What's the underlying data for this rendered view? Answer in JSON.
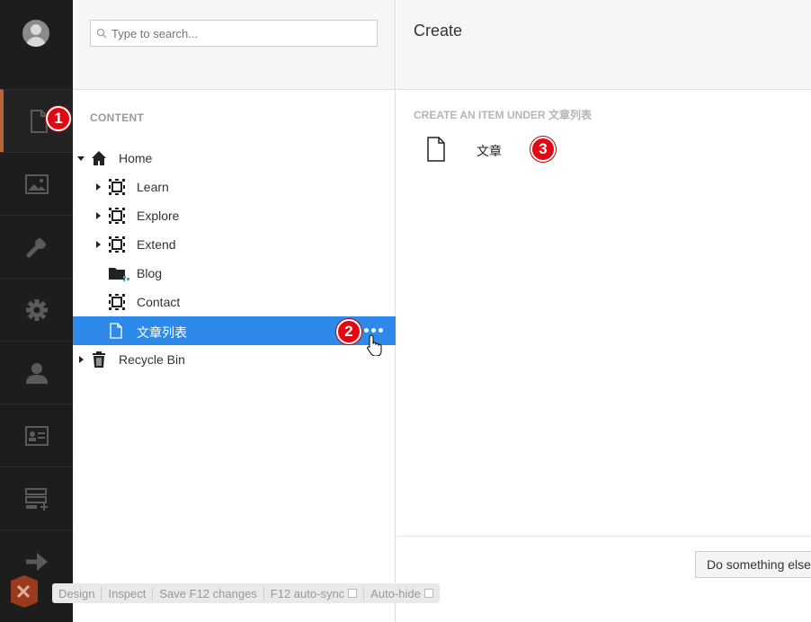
{
  "rail": {
    "items": [
      {
        "name": "content",
        "icon": "document-icon",
        "active": true
      },
      {
        "name": "media",
        "icon": "image-icon"
      },
      {
        "name": "settings",
        "icon": "wrench-icon"
      },
      {
        "name": "developer",
        "icon": "gear-icon"
      },
      {
        "name": "users",
        "icon": "user-icon"
      },
      {
        "name": "members",
        "icon": "id-card-icon"
      },
      {
        "name": "forms",
        "icon": "forms-icon"
      },
      {
        "name": "redirect",
        "icon": "arrow-right-icon"
      }
    ]
  },
  "badges": {
    "b1": "1",
    "b2": "2",
    "b3": "3"
  },
  "search": {
    "placeholder": "Type to search..."
  },
  "tree": {
    "section_title": "CONTENT",
    "nodes": [
      {
        "label": "Home"
      },
      {
        "label": "Learn"
      },
      {
        "label": "Explore"
      },
      {
        "label": "Extend"
      },
      {
        "label": "Blog"
      },
      {
        "label": "Contact"
      },
      {
        "label": "文章列表"
      },
      {
        "label": "Recycle Bin"
      }
    ]
  },
  "main": {
    "title": "Create",
    "create_under": "CREATE AN ITEM UNDER 文章列表",
    "doc_type_label": "文章",
    "footer_button": "Do something else"
  },
  "devbar": {
    "design": "Design",
    "inspect": "Inspect",
    "save": "Save F12 changes",
    "autosync": "F12 auto-sync",
    "autohide": "Auto-hide"
  },
  "colors": {
    "accent": "#2e8aea",
    "rail_bg": "#1d1d1d",
    "rail_active": "#b8623a",
    "badge": "#e30613"
  }
}
